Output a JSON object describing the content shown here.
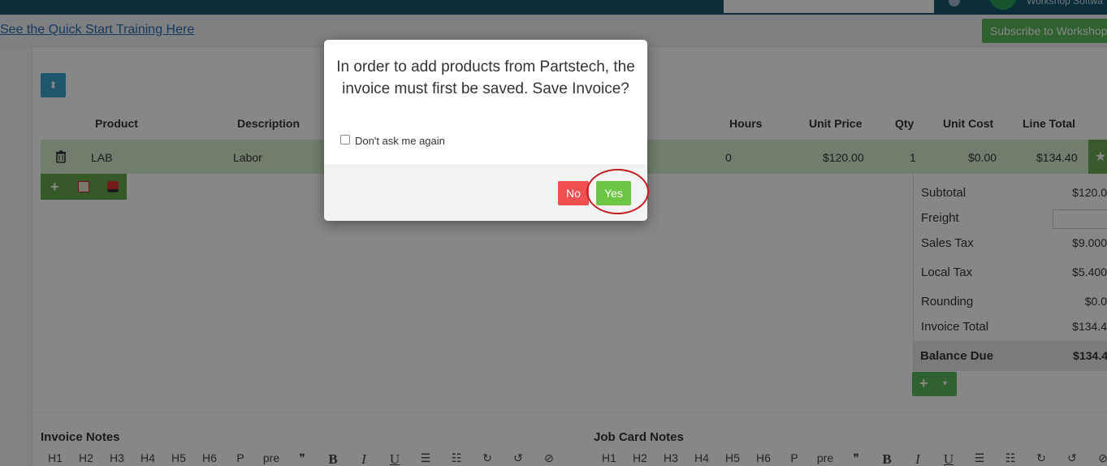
{
  "topbar": {
    "brand_text": "Workshop Softwa"
  },
  "banner": {
    "training_link": "See the Quick Start Training Here",
    "subscribe_label": "Subscribe to Workshop"
  },
  "table": {
    "headers": [
      "Product",
      "Description",
      "Hours",
      "Unit Price",
      "Qty",
      "Unit Cost",
      "Line Total"
    ],
    "rows": [
      {
        "product": "LAB",
        "description": "Labor",
        "hours": "0",
        "unit_price": "$120.00",
        "qty": "1",
        "unit_cost": "$0.00",
        "line_total": "$134.40"
      }
    ]
  },
  "totals": {
    "subtotal_label": "Subtotal",
    "subtotal_value": "$120.0",
    "freight_label": "Freight",
    "sales_tax_label": "Sales Tax",
    "sales_tax_value": "$9.000",
    "local_tax_label": "Local Tax",
    "local_tax_value": "$5.400",
    "rounding_label": "Rounding",
    "rounding_value": "$0.0",
    "invoice_total_label": "Invoice Total",
    "invoice_total_value": "$134.4",
    "balance_due_label": "Balance Due",
    "balance_due_value": "$134.4"
  },
  "notes": {
    "invoice_title": "Invoice Notes",
    "jobcard_title": "Job Card Notes",
    "toolbar": [
      "H1",
      "H2",
      "H3",
      "H4",
      "H5",
      "H6",
      "P",
      "pre",
      "❞",
      "B",
      "I",
      "U",
      "☰",
      "☷",
      "↻",
      "↺",
      "⊘"
    ]
  },
  "modal": {
    "message": "In order to add products from Partstech, the invoice must first be saved. Save Invoice?",
    "checkbox_label": "Don't ask me again",
    "no_label": "No",
    "yes_label": "Yes"
  },
  "colors": {
    "topbar": "#18576f",
    "row_highlight": "#d7efcf",
    "no_button": "#f05050",
    "yes_button": "#6cc644",
    "highlight_ring": "#c0201f"
  }
}
